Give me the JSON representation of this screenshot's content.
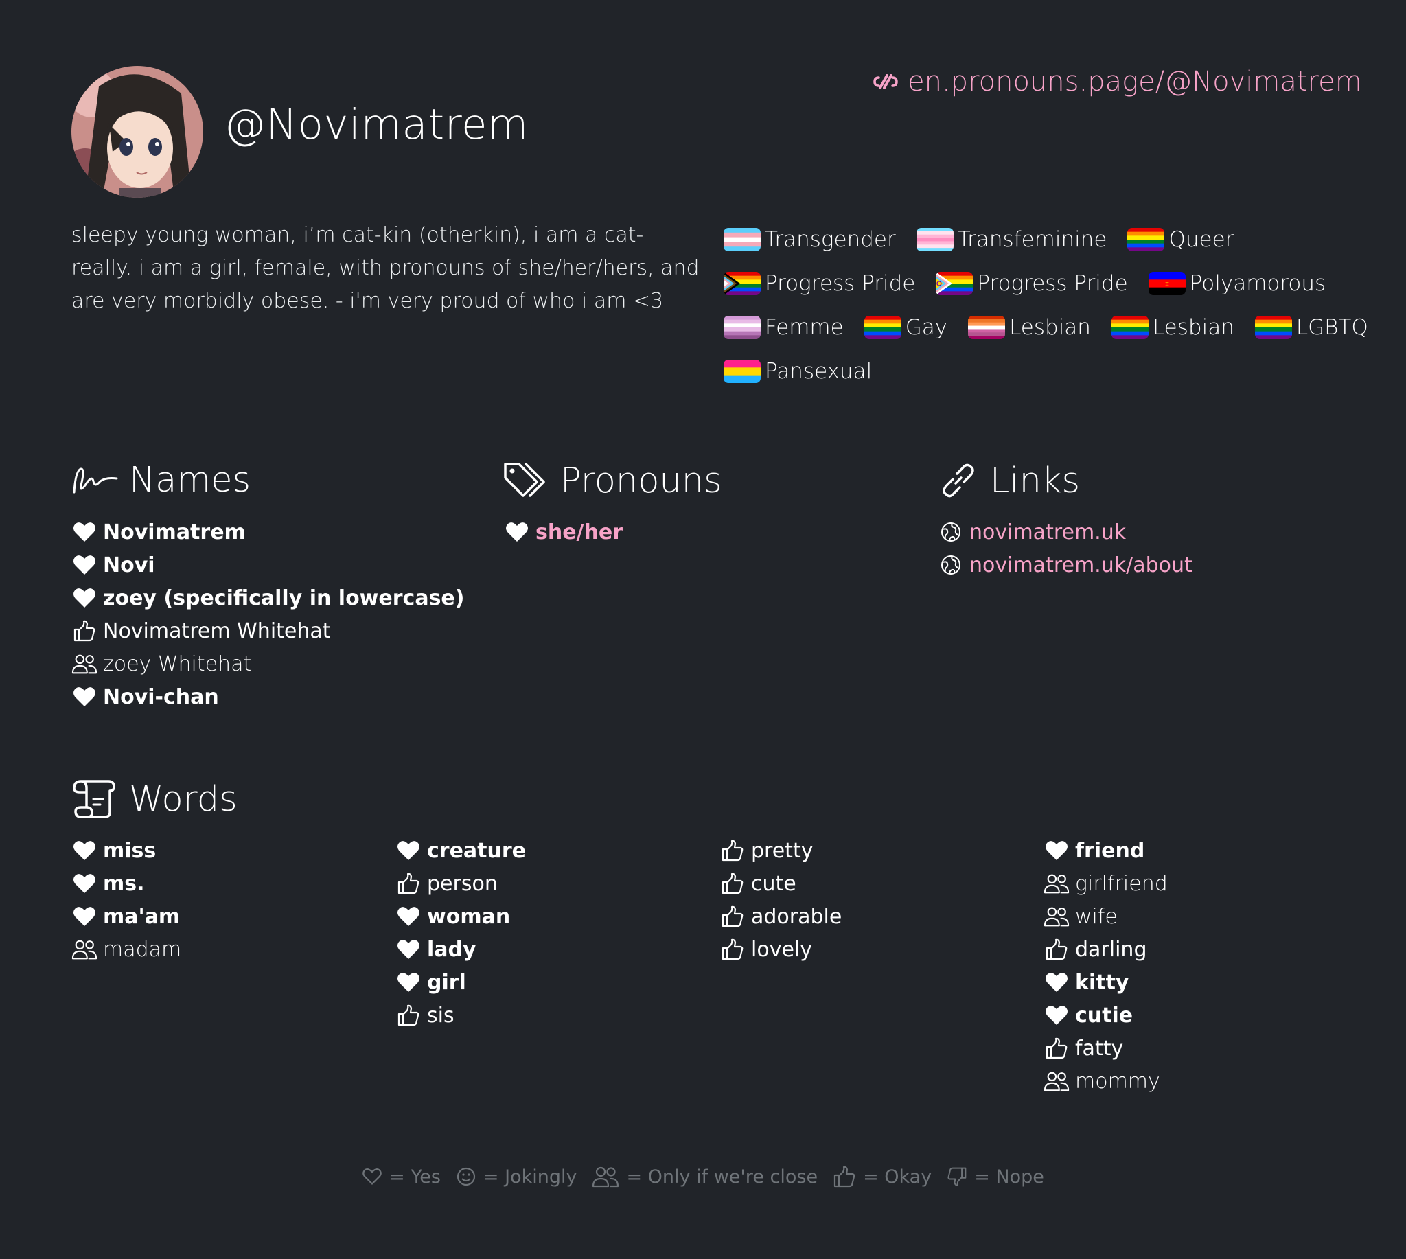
{
  "header": {
    "username": "@Novimatrem",
    "profile_link": "en.pronouns.page/@Novimatrem",
    "bio": "sleepy young woman, i’m cat-kin (otherkin), i am a cat- really. i am a girl, female, with pronouns of she/her/hers, and are very morbidly obese. - i'm very proud of who i am <3"
  },
  "flags": [
    {
      "label": "Transgender",
      "flag": "transgender-flag"
    },
    {
      "label": "Transfeminine",
      "flag": "transfeminine-flag"
    },
    {
      "label": "Queer",
      "flag": "rainbow-flag"
    },
    {
      "label": "Progress Pride",
      "flag": "progress-pride-flag"
    },
    {
      "label": "Progress Pride",
      "flag": "intersex-progress-pride-flag"
    },
    {
      "label": "Polyamorous",
      "flag": "polyamorous-flag"
    },
    {
      "label": "Femme",
      "flag": "femme-flag"
    },
    {
      "label": "Gay",
      "flag": "rainbow-flag"
    },
    {
      "label": "Lesbian",
      "flag": "lesbian-flag"
    },
    {
      "label": "Lesbian",
      "flag": "rainbow-flag"
    },
    {
      "label": "LGBTQ",
      "flag": "rainbow-flag"
    },
    {
      "label": "Pansexual",
      "flag": "pansexual-flag"
    }
  ],
  "sections": {
    "names_title": "Names",
    "pronouns_title": "Pronouns",
    "links_title": "Links",
    "words_title": "Words"
  },
  "names": [
    {
      "text": "Novimatrem",
      "opinion": "yes"
    },
    {
      "text": "Novi",
      "opinion": "yes"
    },
    {
      "text": "zoey (specifically in lowercase)",
      "opinion": "yes"
    },
    {
      "text": "Novimatrem Whitehat",
      "opinion": "okay"
    },
    {
      "text": "zoey Whitehat",
      "opinion": "close"
    },
    {
      "text": "Novi-chan",
      "opinion": "yes"
    }
  ],
  "pronouns": [
    {
      "text": "she/her",
      "opinion": "yes"
    }
  ],
  "links": [
    {
      "text": "novimatrem.uk",
      "icon": "globe-icon"
    },
    {
      "text": "novimatrem.uk/about",
      "icon": "globe-icon"
    }
  ],
  "words": [
    [
      {
        "text": "miss",
        "opinion": "yes"
      },
      {
        "text": "ms.",
        "opinion": "yes"
      },
      {
        "text": "ma'am",
        "opinion": "yes"
      },
      {
        "text": "madam",
        "opinion": "close"
      }
    ],
    [
      {
        "text": "creature",
        "opinion": "yes"
      },
      {
        "text": "person",
        "opinion": "okay"
      },
      {
        "text": "woman",
        "opinion": "yes"
      },
      {
        "text": "lady",
        "opinion": "yes"
      },
      {
        "text": "girl",
        "opinion": "yes"
      },
      {
        "text": "sis",
        "opinion": "okay"
      }
    ],
    [
      {
        "text": "pretty",
        "opinion": "okay"
      },
      {
        "text": "cute",
        "opinion": "okay"
      },
      {
        "text": "adorable",
        "opinion": "okay"
      },
      {
        "text": "lovely",
        "opinion": "okay"
      }
    ],
    [
      {
        "text": "friend",
        "opinion": "yes"
      },
      {
        "text": "girlfriend",
        "opinion": "close"
      },
      {
        "text": "wife",
        "opinion": "close"
      },
      {
        "text": "darling",
        "opinion": "okay"
      },
      {
        "text": "kitty",
        "opinion": "yes"
      },
      {
        "text": "cutie",
        "opinion": "yes"
      },
      {
        "text": "fatty",
        "opinion": "okay"
      },
      {
        "text": "mommy",
        "opinion": "close"
      }
    ]
  ],
  "legend": [
    {
      "icon": "heart-outline-icon",
      "text": "= Yes"
    },
    {
      "icon": "smiley-icon",
      "text": "= Jokingly"
    },
    {
      "icon": "users-icon",
      "text": "= Only if we're close"
    },
    {
      "icon": "thumbs-up-icon",
      "text": "= Okay"
    },
    {
      "icon": "thumbs-down-icon",
      "text": "= Nope"
    }
  ],
  "colors": {
    "background": "#212429",
    "accent": "#f7a3c8",
    "muted": "#6f7479"
  }
}
